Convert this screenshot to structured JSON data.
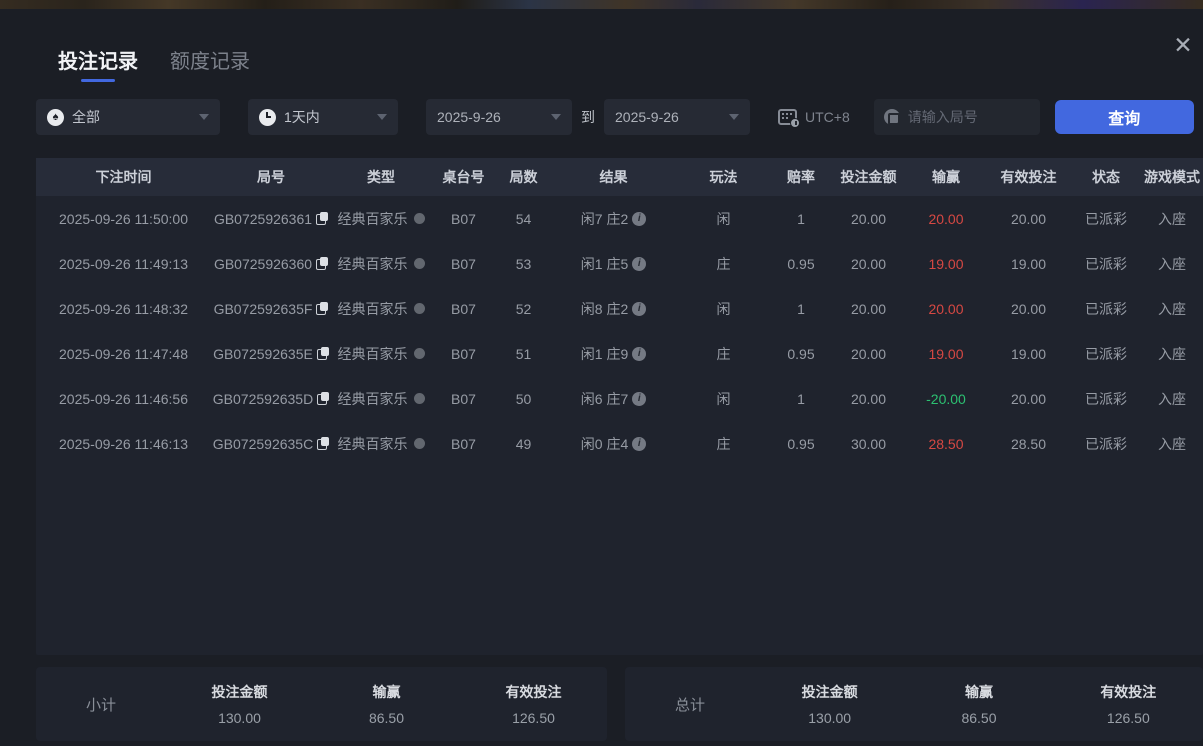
{
  "icons": {
    "close": "✕",
    "spade": "♠"
  },
  "colors": {
    "accent_blue": "#4268df",
    "win_red": "#d64843",
    "loss_green": "#2cc071"
  },
  "tabs": [
    {
      "label": "投注记录",
      "active": true
    },
    {
      "label": "额度记录",
      "active": false
    }
  ],
  "filters": {
    "game_type": "全部",
    "time_range": "1天内",
    "date_from": "2025-9-26",
    "to_label": "到",
    "date_to": "2025-9-26",
    "timezone": "UTC+8",
    "round_placeholder": "请输入局号",
    "search_label": "查询"
  },
  "table": {
    "columns": [
      "下注时间",
      "局号",
      "类型",
      "桌台号",
      "局数",
      "结果",
      "玩法",
      "赔率",
      "投注金额",
      "输赢",
      "有效投注",
      "状态",
      "游戏模式"
    ],
    "rows": [
      {
        "time": "2025-09-26 11:50:00",
        "round_id": "GB0725926361",
        "type": "经典百家乐",
        "table_no": "B07",
        "round_no": "54",
        "result": "闲7 庄2",
        "play": "闲",
        "odds": "1",
        "bet": "20.00",
        "win": "20.00",
        "win_color": "red",
        "valid": "20.00",
        "status": "已派彩",
        "mode": "入座"
      },
      {
        "time": "2025-09-26 11:49:13",
        "round_id": "GB0725926360",
        "type": "经典百家乐",
        "table_no": "B07",
        "round_no": "53",
        "result": "闲1 庄5",
        "play": "庄",
        "odds": "0.95",
        "bet": "20.00",
        "win": "19.00",
        "win_color": "red",
        "valid": "19.00",
        "status": "已派彩",
        "mode": "入座"
      },
      {
        "time": "2025-09-26 11:48:32",
        "round_id": "GB072592635F",
        "type": "经典百家乐",
        "table_no": "B07",
        "round_no": "52",
        "result": "闲8 庄2",
        "play": "闲",
        "odds": "1",
        "bet": "20.00",
        "win": "20.00",
        "win_color": "red",
        "valid": "20.00",
        "status": "已派彩",
        "mode": "入座"
      },
      {
        "time": "2025-09-26 11:47:48",
        "round_id": "GB072592635E",
        "type": "经典百家乐",
        "table_no": "B07",
        "round_no": "51",
        "result": "闲1 庄9",
        "play": "庄",
        "odds": "0.95",
        "bet": "20.00",
        "win": "19.00",
        "win_color": "red",
        "valid": "19.00",
        "status": "已派彩",
        "mode": "入座"
      },
      {
        "time": "2025-09-26 11:46:56",
        "round_id": "GB072592635D",
        "type": "经典百家乐",
        "table_no": "B07",
        "round_no": "50",
        "result": "闲6 庄7",
        "play": "闲",
        "odds": "1",
        "bet": "20.00",
        "win": "-20.00",
        "win_color": "green",
        "valid": "20.00",
        "status": "已派彩",
        "mode": "入座"
      },
      {
        "time": "2025-09-26 11:46:13",
        "round_id": "GB072592635C",
        "type": "经典百家乐",
        "table_no": "B07",
        "round_no": "49",
        "result": "闲0 庄4",
        "play": "庄",
        "odds": "0.95",
        "bet": "30.00",
        "win": "28.50",
        "win_color": "red",
        "valid": "28.50",
        "status": "已派彩",
        "mode": "入座"
      }
    ]
  },
  "summary": {
    "subtotal": {
      "label": "小计",
      "items": [
        {
          "label": "投注金额",
          "value": "130.00"
        },
        {
          "label": "输赢",
          "value": "86.50",
          "color": "red"
        },
        {
          "label": "有效投注",
          "value": "126.50"
        }
      ]
    },
    "total": {
      "label": "总计",
      "items": [
        {
          "label": "投注金额",
          "value": "130.00"
        },
        {
          "label": "输赢",
          "value": "86.50",
          "color": "red"
        },
        {
          "label": "有效投注",
          "value": "126.50"
        }
      ]
    }
  }
}
